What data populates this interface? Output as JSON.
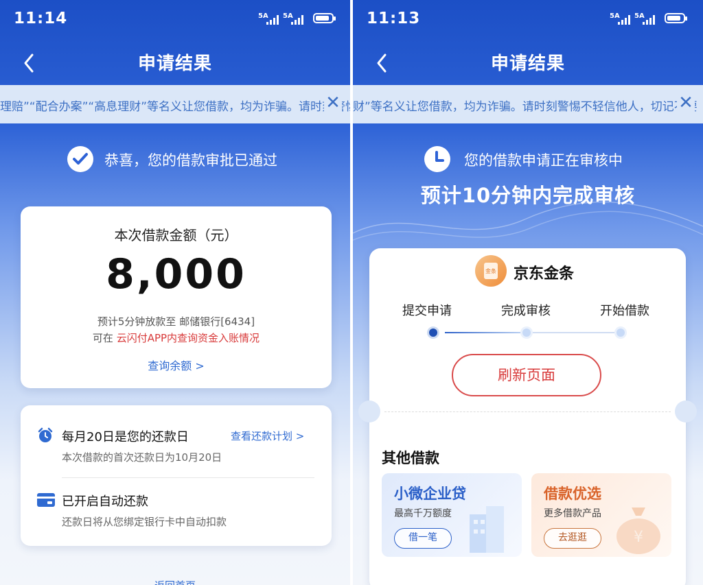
{
  "left": {
    "status": {
      "time": "11:14",
      "sig1": "5A",
      "sig2": "5A"
    },
    "nav": {
      "title": "申请结果"
    },
    "notice": {
      "text": "理赔”“配合办案”“高息理财”等名义让您借款，均为诈骗。请时刻警惕不轻信他人"
    },
    "result": {
      "message": "恭喜，您的借款审批已通过"
    },
    "amount": {
      "label": "本次借款金额（元）",
      "value": "8,000",
      "note1": "预计5分钟放款至 邮储银行[6434]",
      "note2_prefix": "可在 ",
      "note2_highlight": "云闪付APP内查询资金入账情况",
      "balance_link": "查询余额 >"
    },
    "repay": {
      "title": "每月20日是您的还款日",
      "plan_link": "查看还款计划 >",
      "sub": "本次借款的首次还款日为10月20日",
      "auto_title": "已开启自动还款",
      "auto_sub": "还款日将从您绑定银行卡中自动扣款"
    },
    "home_link": "返回首页"
  },
  "right": {
    "status": {
      "time": "11:13",
      "sig1": "5A",
      "sig2": "5A"
    },
    "nav": {
      "title": "申请结果"
    },
    "notice": {
      "text": "财”等名义让您借款，均为诈骗。请时刻警惕不轻信他人，切记不要"
    },
    "pending": {
      "message": "您的借款申请正在审核中",
      "eta": "预计10分钟内完成审核"
    },
    "brand": {
      "name": "京东金条",
      "logo_text": "金条"
    },
    "steps": [
      "提交申请",
      "完成审核",
      "开始借款"
    ],
    "refresh_label": "刷新页面",
    "other": {
      "title": "其他借款",
      "items": [
        {
          "name": "小微企业贷",
          "sub": "最高千万额度",
          "button": "借一笔"
        },
        {
          "name": "借款优选",
          "sub": "更多借款产品",
          "button": "去逛逛"
        }
      ]
    }
  },
  "colors": {
    "brand_blue": "#2d62d6",
    "link_blue": "#2f6ad1",
    "alert_red": "#d83a3a",
    "notice_bg": "#dbe7f8"
  }
}
